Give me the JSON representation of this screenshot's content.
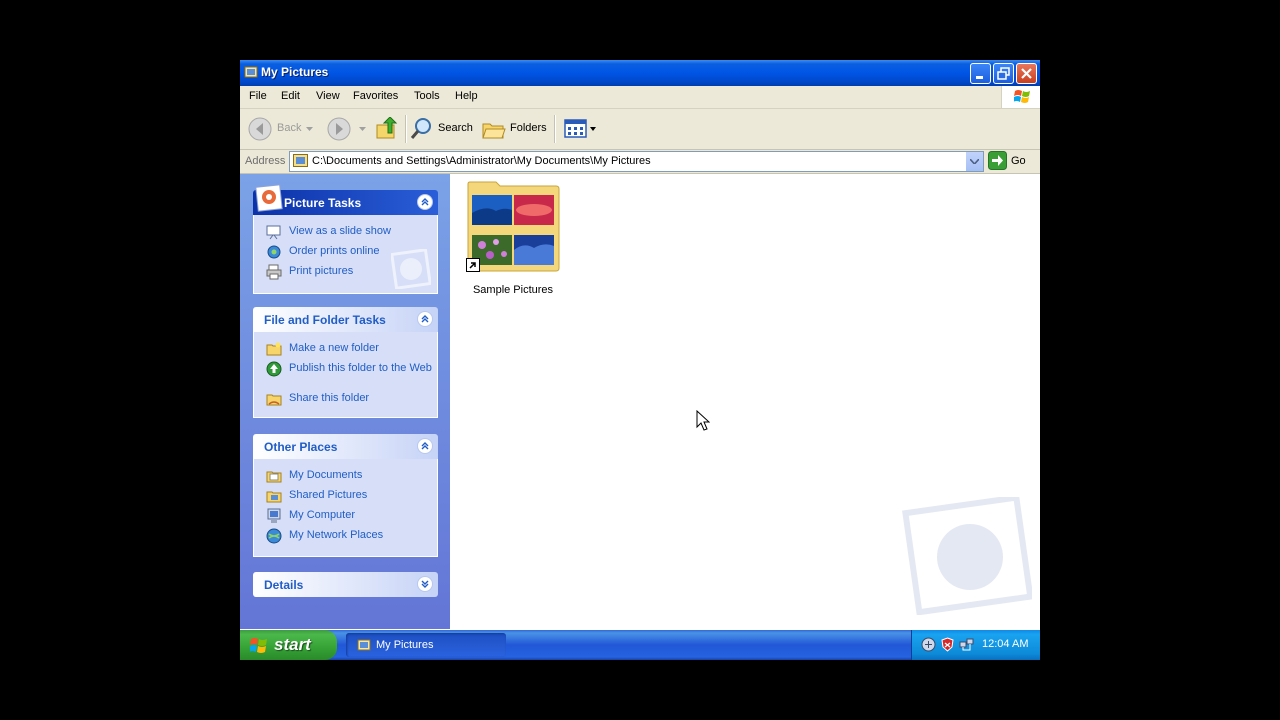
{
  "window": {
    "title": "My Pictures",
    "buttons": {
      "minimize": "minimize",
      "maximize": "maximize",
      "close": "close"
    }
  },
  "menu": [
    "File",
    "Edit",
    "View",
    "Favorites",
    "Tools",
    "Help"
  ],
  "toolbar": {
    "back": "Back",
    "search": "Search",
    "folders": "Folders"
  },
  "address": {
    "label": "Address",
    "path": "C:\\Documents and Settings\\Administrator\\My Documents\\My Pictures",
    "go": "Go"
  },
  "taskpane": {
    "picture_tasks": {
      "title": "Picture Tasks",
      "items": [
        "View as a slide show",
        "Order prints online",
        "Print pictures"
      ]
    },
    "file_folder_tasks": {
      "title": "File and Folder Tasks",
      "items": [
        "Make a new folder",
        "Publish this folder to the Web",
        "Share this folder"
      ]
    },
    "other_places": {
      "title": "Other Places",
      "items": [
        "My Documents",
        "Shared Pictures",
        "My Computer",
        "My Network Places"
      ]
    },
    "details": {
      "title": "Details"
    }
  },
  "content": {
    "items": [
      {
        "label": "Sample Pictures"
      }
    ]
  },
  "taskbar": {
    "start": "start",
    "task_button": "My Pictures",
    "clock": "12:04 AM"
  },
  "colors": {
    "titlebar": "#0055e5",
    "taskpane_link": "#215dc6",
    "start": "#36a236",
    "tray": "#0d8ad8"
  }
}
